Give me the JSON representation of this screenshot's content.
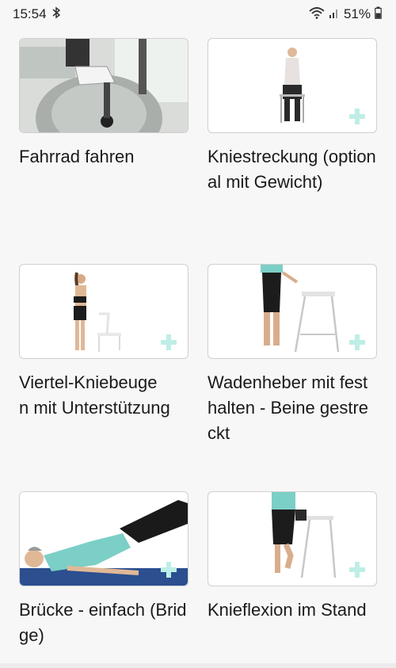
{
  "status_bar": {
    "time": "15:54",
    "battery": "51%",
    "icons": [
      "bluetooth-icon",
      "wifi-icon",
      "signal-icon",
      "battery-icon"
    ]
  },
  "exercises": [
    {
      "title": "Fahrrad fahren",
      "thumbnail": "stationary-bike-image"
    },
    {
      "title": "Kniestreckung (optional mit Gewicht)",
      "thumbnail": "seated-knee-extension-image"
    },
    {
      "title": "Viertel-Kniebeuge\nn mit Unterstützung",
      "thumbnail": "quarter-squat-with-chair-image"
    },
    {
      "title": "Wadenheber mit festhalten - Beine gestreckt",
      "thumbnail": "calf-raise-with-stool-image"
    },
    {
      "title": "Brücke - einfach (Bridge)",
      "thumbnail": "bridge-exercise-image"
    },
    {
      "title": "Knieflexion im Stand",
      "thumbnail": "standing-knee-flexion-image"
    }
  ],
  "colors": {
    "background": "#f7f7f7",
    "card_border": "#cfcfcf",
    "plus_accent": "#bfeee6",
    "shirt": "#7ccfc6",
    "mat": "#2b4f8f"
  }
}
